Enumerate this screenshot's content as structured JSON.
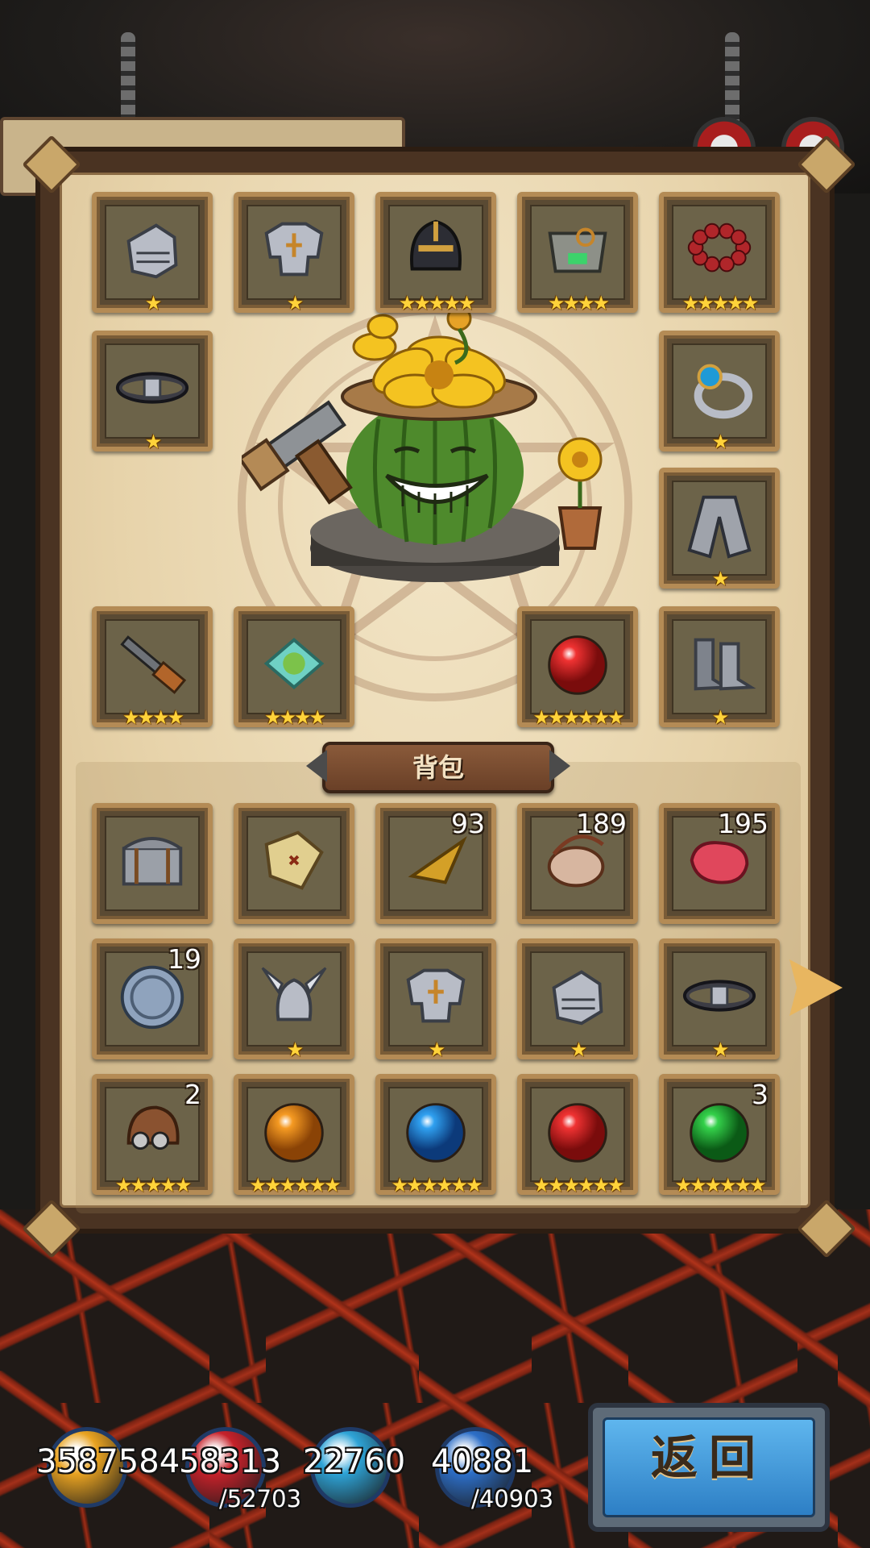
{
  "backpack_title": "背包",
  "equipped_slots": [
    {
      "name": "gauntlets",
      "stars": "★"
    },
    {
      "name": "chest-armor",
      "stars": "★"
    },
    {
      "name": "knight-helmet",
      "stars": "★★★★★"
    },
    {
      "name": "armor-piece",
      "stars": "★★★★"
    },
    {
      "name": "red-bead-necklace",
      "stars": "★★★★★"
    },
    {
      "name": "belt",
      "stars": "★"
    },
    {
      "name": "sapphire-ring",
      "stars": "★"
    },
    {
      "name": "cape",
      "stars": "★"
    },
    {
      "name": "rifle",
      "stars": "★★★★"
    },
    {
      "name": "green-rune-tile",
      "stars": "★★★★"
    },
    {
      "name": "red-orb",
      "stars": "★★★★★★"
    },
    {
      "name": "iron-boots",
      "stars": "★"
    }
  ],
  "backpack_items": [
    {
      "name": "chest",
      "stars": "",
      "qty": ""
    },
    {
      "name": "treasure-map",
      "stars": "",
      "qty": ""
    },
    {
      "name": "golden-horn",
      "stars": "",
      "qty": "93"
    },
    {
      "name": "pouch",
      "stars": "",
      "qty": "189"
    },
    {
      "name": "red-meat",
      "stars": "",
      "qty": "195"
    },
    {
      "name": "silver-coin",
      "stars": "",
      "qty": "19"
    },
    {
      "name": "winged-helmet",
      "stars": "★",
      "qty": ""
    },
    {
      "name": "chest-armor",
      "stars": "★",
      "qty": ""
    },
    {
      "name": "gauntlets",
      "stars": "★",
      "qty": ""
    },
    {
      "name": "belt",
      "stars": "★",
      "qty": ""
    },
    {
      "name": "aviator-cap",
      "stars": "★★★★★",
      "qty": "2"
    },
    {
      "name": "orange-orb",
      "stars": "★★★★★★",
      "qty": ""
    },
    {
      "name": "blue-orb",
      "stars": "★★★★★★",
      "qty": ""
    },
    {
      "name": "red-orb",
      "stars": "★★★★★★",
      "qty": ""
    },
    {
      "name": "green-orb",
      "stars": "★★★★★★",
      "qty": "3"
    }
  ],
  "currencies": [
    {
      "name": "gold",
      "value": "3587584",
      "max": "",
      "color": "#e9a321"
    },
    {
      "name": "hp",
      "value": "58313",
      "max": "/52703",
      "color": "#c6212a"
    },
    {
      "name": "mana",
      "value": "22760",
      "max": "",
      "color": "#2ea3d6"
    },
    {
      "name": "mp",
      "value": "40881",
      "max": "/40903",
      "color": "#2d6fc8"
    }
  ],
  "back_button": "返回"
}
